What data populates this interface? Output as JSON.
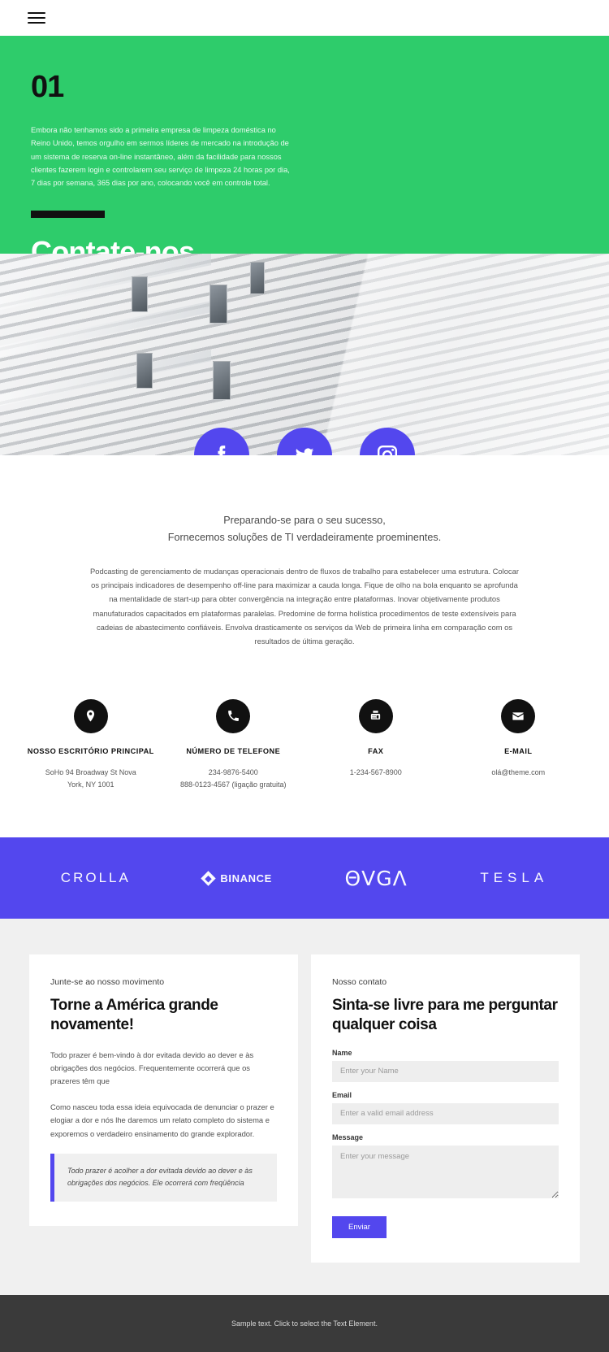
{
  "header": {
    "menu_icon": "hamburger-menu-icon"
  },
  "hero": {
    "number": "01",
    "paragraph": "Embora não tenhamos sido a primeira empresa de limpeza doméstica no Reino Unido, temos orgulho em sermos líderes de mercado na introdução de um sistema de reserva on-line instantâneo, além da facilidade para nossos clientes fazerem login e controlarem seu serviço de limpeza 24 horas por dia, 7 dias por semana, 365 dias por ano, colocando você em controle total.",
    "title": "Contate-nos"
  },
  "social": {
    "items": [
      {
        "name": "facebook-icon",
        "label": "Facebook"
      },
      {
        "name": "twitter-icon",
        "label": "Twitter"
      },
      {
        "name": "instagram-icon",
        "label": "Instagram"
      }
    ],
    "brand_color": "#5347ee"
  },
  "intro": {
    "lead_line1": "Preparando-se para o seu sucesso,",
    "lead_line2": "Fornecemos soluções de TI verdadeiramente proeminentes.",
    "body": "Podcasting de gerenciamento de mudanças operacionais dentro de fluxos de trabalho para estabelecer uma estrutura. Colocar os principais indicadores de desempenho off-line para maximizar a cauda longa. Fique de olho na bola enquanto se aprofunda na mentalidade de start-up para obter convergência na integração entre plataformas. Inovar objetivamente produtos manufaturados capacitados em plataformas paralelas. Predomine de forma holística procedimentos de teste extensíveis para cadeias de abastecimento confiáveis. Envolva drasticamente os serviços da Web de primeira linha em comparação com os resultados de última geração."
  },
  "contacts": [
    {
      "icon": "map-pin-icon",
      "title": "NOSSO ESCRITÓRIO PRINCIPAL",
      "lines": [
        "SoHo 94 Broadway St Nova",
        "York, NY 1001"
      ]
    },
    {
      "icon": "phone-icon",
      "title": "NÚMERO DE TELEFONE",
      "lines": [
        "234-9876-5400",
        "888-0123-4567 (ligação gratuita)"
      ]
    },
    {
      "icon": "fax-icon",
      "title": "FAX",
      "lines": [
        "1-234-567-8900"
      ]
    },
    {
      "icon": "envelope-icon",
      "title": "E-MAIL",
      "lines": [
        "olá@theme.com"
      ]
    }
  ],
  "brands": {
    "background": "#5347ee",
    "items": [
      {
        "name": "crolla-logo",
        "label": "CROLLA"
      },
      {
        "name": "binance-logo",
        "label": "BINANCE"
      },
      {
        "name": "evga-logo",
        "label": "ΘVGΛ"
      },
      {
        "name": "tesla-logo",
        "label": "TESLA"
      }
    ]
  },
  "left_card": {
    "eyebrow": "Junte-se ao nosso movimento",
    "title": "Torne a América grande novamente!",
    "paragraph1": "Todo prazer é bem-vindo à dor evitada devido ao dever e às obrigações dos negócios. Frequentemente ocorrerá que os prazeres têm que",
    "paragraph2": "Como nasceu toda essa ideia equivocada de denunciar o prazer e elogiar a dor e nós lhe daremos um relato completo do sistema e exporemos o verdadeiro ensinamento do grande explorador.",
    "quote": "Todo prazer é acolher a dor evitada devido ao dever e às obrigações dos negócios. Ele ocorrerá com freqüência"
  },
  "form_card": {
    "eyebrow": "Nosso contato",
    "title": "Sinta-se livre para me perguntar qualquer coisa",
    "fields": [
      {
        "label": "Name",
        "placeholder": "Enter your Name",
        "value": ""
      },
      {
        "label": "Email",
        "placeholder": "Enter a valid email address",
        "value": ""
      },
      {
        "label": "Message",
        "placeholder": "Enter your message",
        "value": ""
      }
    ],
    "submit_label": "Enviar",
    "submit_color": "#5347ee"
  },
  "footer": {
    "text": "Sample text. Click to select the Text Element."
  }
}
